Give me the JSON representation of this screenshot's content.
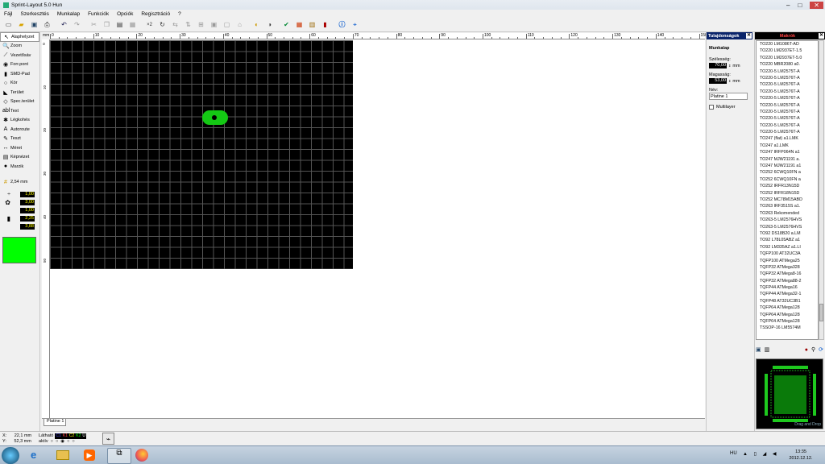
{
  "window": {
    "title": "Sprint-Layout 5.0 Hun",
    "min": "–",
    "max": "□",
    "close": "✕"
  },
  "menu": [
    "Fájl",
    "Szerkesztés",
    "Munkalap",
    "Funkciók",
    "Opciók",
    "Regisztráció",
    "?"
  ],
  "toolbar": {
    "x2_label": "×2"
  },
  "tools": [
    {
      "icon": "pointer-icon",
      "glyph": "↖",
      "label": "Alaphelyzet",
      "selected": true
    },
    {
      "icon": "zoom-icon",
      "glyph": "🔍",
      "label": "Zoom"
    },
    {
      "icon": "track-icon",
      "glyph": "⟋",
      "label": "Vezetősáv"
    },
    {
      "icon": "pad-icon",
      "glyph": "◉",
      "label": "Forr.pont"
    },
    {
      "icon": "smd-icon",
      "glyph": "▮",
      "label": "SMD-Pad"
    },
    {
      "icon": "circle-icon",
      "glyph": "○",
      "label": "Kör"
    },
    {
      "icon": "zone-icon",
      "glyph": "◣",
      "label": "Terület"
    },
    {
      "icon": "special-zone-icon",
      "glyph": "◇",
      "label": "Spec.terület"
    },
    {
      "icon": "text-icon",
      "glyph": "abl",
      "label": "Text"
    },
    {
      "icon": "airwire-icon",
      "glyph": "✱",
      "label": "Légkohés"
    },
    {
      "icon": "autoroute-icon",
      "glyph": "A",
      "label": "Autoroute"
    },
    {
      "icon": "test-icon",
      "glyph": "✎",
      "label": "Teszt"
    },
    {
      "icon": "measure-icon",
      "glyph": "↔",
      "label": "Méret"
    },
    {
      "icon": "photo-icon",
      "glyph": "▤",
      "label": "Képnézet"
    },
    {
      "icon": "macro-icon",
      "glyph": "●",
      "label": "Marzik"
    }
  ],
  "grid": {
    "label": "2,54 mm"
  },
  "values": {
    "track_width": "1,00",
    "pad_outer": "3,00",
    "pad_inner": "1,00",
    "smd_w": "2,25",
    "smd_h": "3,88"
  },
  "ruler": {
    "top": [
      "mm",
      "0",
      "10",
      "20",
      "30",
      "40",
      "50",
      "60",
      "70",
      "80",
      "90",
      "100",
      "110",
      "120",
      "130",
      "140",
      "150"
    ],
    "left": [
      "0",
      "10",
      "20",
      "30",
      "40",
      "50"
    ]
  },
  "tab": {
    "label": "Platine 1"
  },
  "properties": {
    "header": "Tulajdonságok",
    "section": "Munkalap",
    "width_label": "Szélesség:",
    "width_value": "70,00",
    "height_label": "Magasság:",
    "height_value": "53,00",
    "unit": "mm",
    "name_label": "Név:",
    "name_value": "Platine 1",
    "multilayer": "Multilayer"
  },
  "macros": {
    "header": "Makrók",
    "items": [
      "TO220 LM1086T-AD",
      "TO220 LM2937ET-1.5",
      "TO220 LM2937ET-5.0",
      "TO220 MBR2080 a0.",
      "TO220-5 LM2575T-A",
      "TO220-5 LM2576T-A",
      "TO220-5 LM2576T-A",
      "TO220-5 LM2576T-A",
      "TO220-5 LM2576T-A",
      "TO220-5 LM2576T-A",
      "TO220-5 LM2576T-A",
      "TO220-5 LM2576T-A",
      "TO220-5 LM2576T-A",
      "TO220-5 LM2576T-A",
      "TO247 (flat) a1.LMK",
      "TO247 a1.LMK",
      "TO247 IRFP064N a1",
      "TO247 MJW21191 a.",
      "TO247 MJW21191 a1",
      "TO252 6CWQ10FN a",
      "TO252 6CWQ10FN a",
      "TO252 IRFR13N15D",
      "TO252 IRFR18N15D",
      "TO252 MC78M15ABD",
      "TO263 IRF3515S a1.",
      "TO263 Rekomended",
      "TO263-5 LM2576HVS",
      "TO263-5 LM2576HVS",
      "TO92 DS18B20 a.LM",
      "TO92 L78L05ABZ a1",
      "TO92 LM335AZ a1.LI",
      "TQFP100 AT32UC3A",
      "TQFP100 ATMega25",
      "TQFP32 ATMega328",
      "TQFP32 ATMega8-16",
      "TQFP32 ATMega88-2",
      "TQFP44 ATMega16",
      "TQFP44 ATMega32-1",
      "TQFP48 AT32UC3B1",
      "TQFP64 ATMega128",
      "TQFP64 ATMega128",
      "TQFP64 ATMega128",
      "TSSOP-16 LM5574M"
    ],
    "preview_label": "Drag and Drop"
  },
  "status": {
    "x_label": "X:",
    "x_value": "22,1 mm",
    "y_label": "Y:",
    "y_value": "52,3 mm",
    "visible_label": "Látható",
    "active_label": "aktív",
    "layers": [
      "C1",
      "K1",
      "C2",
      "K2",
      "U"
    ]
  },
  "taskbar": {
    "lang": "HU",
    "time": "13:35",
    "date": "2012.12.12."
  },
  "colors": {
    "board": "#000000",
    "pad": "#14c814",
    "accent": "#00ff00",
    "panel": "#0a246a"
  }
}
